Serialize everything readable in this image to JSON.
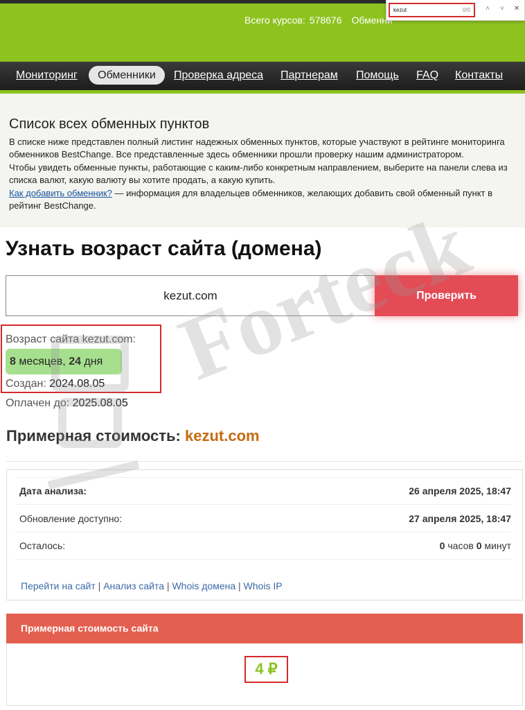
{
  "header": {
    "courses_label": "Всего курсов:",
    "courses_count": "578676",
    "exchangers_partial": "Обменни"
  },
  "findbar": {
    "query": "kezut",
    "count": "0/0",
    "up_icon": "chevron-up-icon",
    "down_icon": "chevron-down-icon",
    "close_icon": "close-icon"
  },
  "nav": {
    "items": [
      "Мониторинг",
      "Обменники",
      "Проверка адреса",
      "Партнерам",
      "Помощь",
      "FAQ",
      "Контакты"
    ],
    "active": "Обменники"
  },
  "intro": {
    "title": "Список всех обменных пунктов",
    "p1": "В списке ниже представлен полный листинг надежных обменных пунктов, которые участвуют в рейтинге мониторинга обменников BestChange. Все представленные здесь обменники прошли проверку нашим администратором.",
    "p2": "Чтобы увидеть обменные пункты, работающие с каким-либо конкретным направлением, выберите на панели слева из списка валют, какую валюту вы хотите продать, а какую купить.",
    "link": "Как добавить обменник?",
    "link_tail": " — информация для владельцев обменников, желающих добавить свой обменный пункт в рейтинг BestChange."
  },
  "age": {
    "title": "Узнать возраст сайта (домена)",
    "input_value": "kezut.com",
    "check_button": "Проверить",
    "age_label": "Возраст сайта kezut.com:",
    "months": "8",
    "months_word": " месяцев, ",
    "days": "24",
    "days_word": " дня",
    "created_label": "Создан: ",
    "created_value": "2024.08.05",
    "paid_label": "Оплачен до: ",
    "paid_value": "2025.08.05"
  },
  "cost": {
    "title": "Примерная стоимость: ",
    "domain": "kezut.com",
    "rows": {
      "analysis_label": "Дата анализа:",
      "analysis_value": "26 апреля 2025, 18:47",
      "update_label": "Обновление доступно:",
      "update_value": "27 апреля 2025, 18:47",
      "left_label": "Осталось:",
      "left_hours": "0",
      "left_hours_unit": " часов ",
      "left_minutes": "0",
      "left_minutes_unit": " минут"
    },
    "links": [
      "Перейти на сайт",
      "Анализ сайта",
      "Whois домена",
      "Whois IP"
    ],
    "link_sep": " | ",
    "price_head": "Примерная стоимость сайта",
    "price_value": "4 ₽"
  },
  "watermark": "Forteck"
}
